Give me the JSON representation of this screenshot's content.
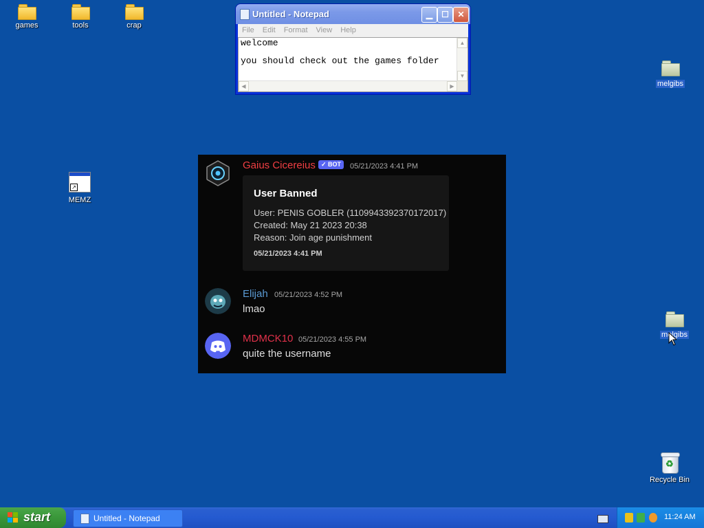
{
  "desktop": {
    "icons": [
      {
        "label": "games",
        "type": "folder"
      },
      {
        "label": "tools",
        "type": "folder"
      },
      {
        "label": "crap",
        "type": "folder"
      },
      {
        "label": "MEMZ",
        "type": "shortcut"
      },
      {
        "label": "melgibs",
        "type": "folder"
      },
      {
        "label": "melgibs",
        "type": "folder"
      },
      {
        "label": "Recycle Bin",
        "type": "recycle-bin"
      }
    ]
  },
  "notepad": {
    "title": "Untitled - Notepad",
    "menu": [
      "File",
      "Edit",
      "Format",
      "View",
      "Help"
    ],
    "line1": "welcome",
    "line2": "you should check out the games folder"
  },
  "discord": {
    "messages": [
      {
        "author": "Gaius Cicereius",
        "badge": "✓ BOT",
        "timestamp": "05/21/2023 4:41 PM",
        "author_color": "#f23f43",
        "embed": {
          "title": "User Banned",
          "user_line": "User: PENIS GOBLER (1109943392370172017)",
          "created_line": "Created: May 21 2023 20:38",
          "reason_line": "Reason: Join age punishment",
          "footer": "05/21/2023 4:41 PM"
        }
      },
      {
        "author": "Elijah",
        "timestamp": "05/21/2023 4:52 PM",
        "author_color": "#5b9bd5",
        "text": "lmao"
      },
      {
        "author": "MDMCK10",
        "timestamp": "05/21/2023 4:55 PM",
        "author_color": "#e0314a",
        "text": "quite the username"
      }
    ]
  },
  "taskbar": {
    "start_label": "start",
    "task_button": "Untitled - Notepad",
    "clock": "11:24 AM"
  },
  "colors": {
    "desktop_bg": "#0a4fa3",
    "discord_bg": "#070707",
    "discord_blurple": "#5865f2"
  }
}
